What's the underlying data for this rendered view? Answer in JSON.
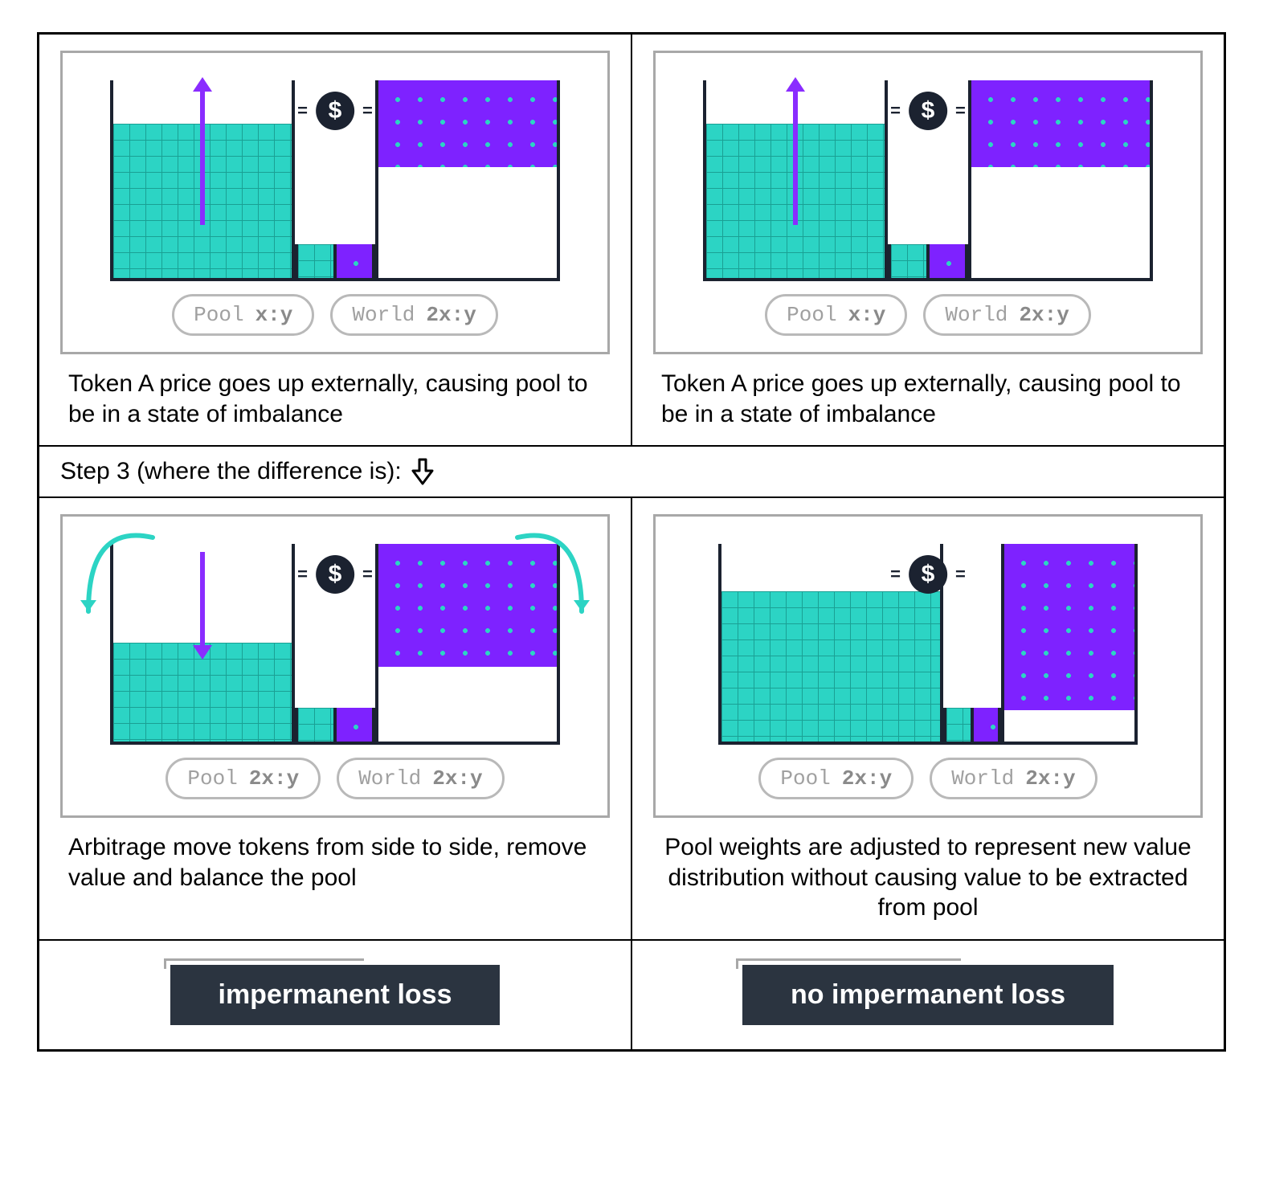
{
  "panels": {
    "top_left": {
      "pool_label": "Pool",
      "pool_ratio": "x:y",
      "world_label": "World",
      "world_ratio": "2x:y",
      "eq": "=",
      "dollar": "$",
      "caption": "Token A price goes up externally, causing pool to be in a state of imbalance"
    },
    "top_right": {
      "pool_label": "Pool",
      "pool_ratio": "x:y",
      "world_label": "World",
      "world_ratio": "2x:y",
      "eq": "=",
      "dollar": "$",
      "caption": "Token A price goes up externally, causing pool to be in a state of imbalance"
    },
    "bottom_left": {
      "pool_label": "Pool",
      "pool_ratio": "2x:y",
      "world_label": "World",
      "world_ratio": "2x:y",
      "eq": "=",
      "dollar": "$",
      "caption": "Arbitrage move tokens from side to side, remove value and balance the pool"
    },
    "bottom_right": {
      "pool_label": "Pool",
      "pool_ratio": "2x:y",
      "world_label": "World",
      "world_ratio": "2x:y",
      "eq": "=",
      "dollar": "$",
      "caption": "Pool weights are adjusted to represent new value distribution without causing value to be extracted from pool"
    }
  },
  "step_divider": "Step 3 (where the difference is):",
  "results": {
    "left": "impermanent loss",
    "right": "no impermanent loss"
  },
  "colors": {
    "teal": "#2cd4c4",
    "purple": "#7e22ff",
    "dark": "#2b3440",
    "border": "#a8a8a8"
  }
}
